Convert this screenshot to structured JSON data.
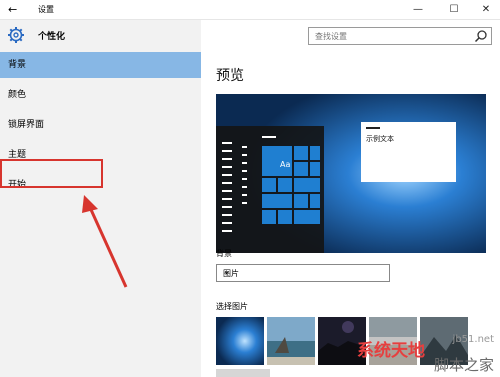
{
  "window": {
    "title": "设置",
    "back_glyph": "←",
    "min_glyph": "—",
    "max_glyph": "☐",
    "close_glyph": "✕"
  },
  "sidebar": {
    "title": "个性化",
    "items": [
      {
        "label": "背景"
      },
      {
        "label": "颜色"
      },
      {
        "label": "锁屏界面"
      },
      {
        "label": "主题"
      },
      {
        "label": "开始"
      }
    ]
  },
  "search": {
    "placeholder": "查找设置"
  },
  "content": {
    "heading": "预览",
    "preview": {
      "tile_label": "Aa",
      "sample_text": "示例文本"
    },
    "background_label": "背景",
    "background_select_value": "图片",
    "choose_picture_label": "选择图片"
  },
  "watermark": {
    "text1": "系统天地",
    "text2": "jb51.net",
    "text3": "脚本之家"
  },
  "colors": {
    "active_item": "#87b7e5",
    "highlight_box": "#d7352e",
    "preview_bg": "#0b2a52",
    "tile_blue": "#1f7fd1"
  }
}
